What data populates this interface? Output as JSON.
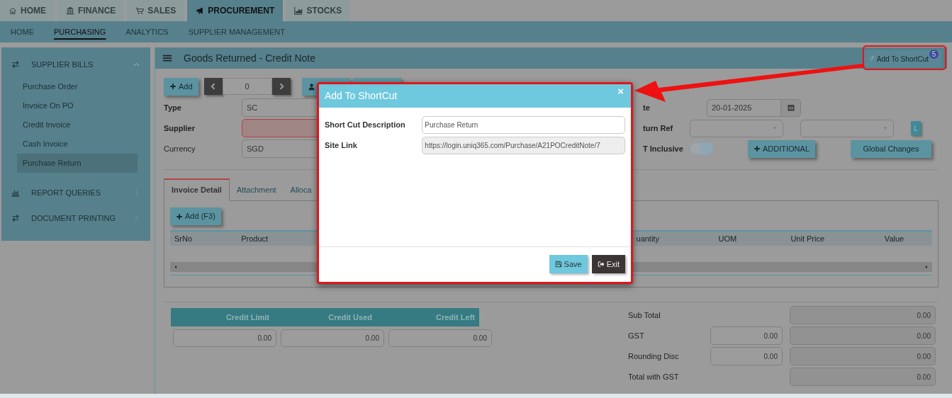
{
  "top_tabs": [
    {
      "label": "HOME",
      "kind": "home",
      "selected": false
    },
    {
      "label": "FINANCE",
      "kind": "finance",
      "selected": false
    },
    {
      "label": "SALES",
      "kind": "sales",
      "selected": false
    },
    {
      "label": "PROCUREMENT",
      "kind": "procurement",
      "selected": true
    },
    {
      "label": "STOCKS",
      "kind": "stocks",
      "selected": false
    }
  ],
  "sub_nav": [
    {
      "label": "HOME",
      "selected": false
    },
    {
      "label": "PURCHASING",
      "selected": true
    },
    {
      "label": "ANALYTICS",
      "selected": false
    },
    {
      "label": "SUPPLIER MANAGEMENT",
      "selected": false
    }
  ],
  "sidebar": {
    "sections": [
      {
        "title": "SUPPLIER BILLS",
        "kind": "transfer",
        "expanded": true,
        "items": [
          {
            "label": "Purchase Order",
            "selected": false
          },
          {
            "label": "Invoice On PO",
            "selected": false
          },
          {
            "label": "Credit Invoice",
            "selected": false
          },
          {
            "label": "Cash Invoice",
            "selected": false
          },
          {
            "label": "Purchase Return",
            "selected": true
          }
        ]
      },
      {
        "title": "REPORT QUERIES",
        "kind": "report",
        "expanded": false
      },
      {
        "title": "DOCUMENT PRINTING",
        "kind": "transfer",
        "expanded": false
      }
    ]
  },
  "page": {
    "title": "Goods Returned - Credit Note",
    "shortcut_button": {
      "label": "Add To ShortCut",
      "count": "5"
    }
  },
  "toolbar": {
    "add_label": "Add",
    "record_number": "0"
  },
  "form_left": [
    {
      "label": "Type",
      "value": "SC",
      "required": true,
      "invalid": false
    },
    {
      "label": "Supplier",
      "required": true,
      "invalid": true
    },
    {
      "label": "Currency",
      "value": "SGD",
      "required": false,
      "invalid": false
    }
  ],
  "form_right": {
    "date": {
      "label": "te",
      "value": "20-01-2025"
    },
    "return_ref": {
      "label": "turn Ref",
      "l_button": "L"
    },
    "gst": {
      "label": "T Inclusive",
      "on": false
    },
    "additional_button": "ADDITIONAL",
    "global_button": "Global Changes"
  },
  "detail_tabs": [
    {
      "label": "Invoice Detail",
      "selected": true
    },
    {
      "label": "Attachment",
      "selected": false
    },
    {
      "label": "Alloca",
      "selected": false
    }
  ],
  "detail_add": "Add (F3)",
  "table": {
    "columns": [
      "SrNo",
      "Product",
      "uantity",
      "UOM",
      "Unit Price",
      "Value"
    ]
  },
  "credit": {
    "columns": [
      "Credit Limit",
      "Credit Used",
      "Credit Left"
    ],
    "values": [
      "0.00",
      "0.00",
      "0.00"
    ]
  },
  "totals": [
    {
      "label": "Sub Total",
      "values": [
        "0.00"
      ]
    },
    {
      "label": "GST",
      "values": [
        "0.00",
        "0.00"
      ]
    },
    {
      "label": "Rounding Disc",
      "values": [
        "0.00",
        "0.00"
      ]
    },
    {
      "label": "Total with GST",
      "values": [
        "0.00"
      ]
    }
  ],
  "modal": {
    "title": "Add To ShortCut",
    "close": "×",
    "fields": [
      {
        "label": "Short Cut Description",
        "value": "Purchase Return",
        "readonly": false
      },
      {
        "label": "Site Link",
        "value": "https://login.uniq365.com/Purchase/A21POCreditNote/7",
        "readonly": true
      }
    ],
    "buttons": [
      {
        "label": "Save",
        "kind": "save"
      },
      {
        "label": "Exit",
        "kind": "exit"
      }
    ]
  }
}
